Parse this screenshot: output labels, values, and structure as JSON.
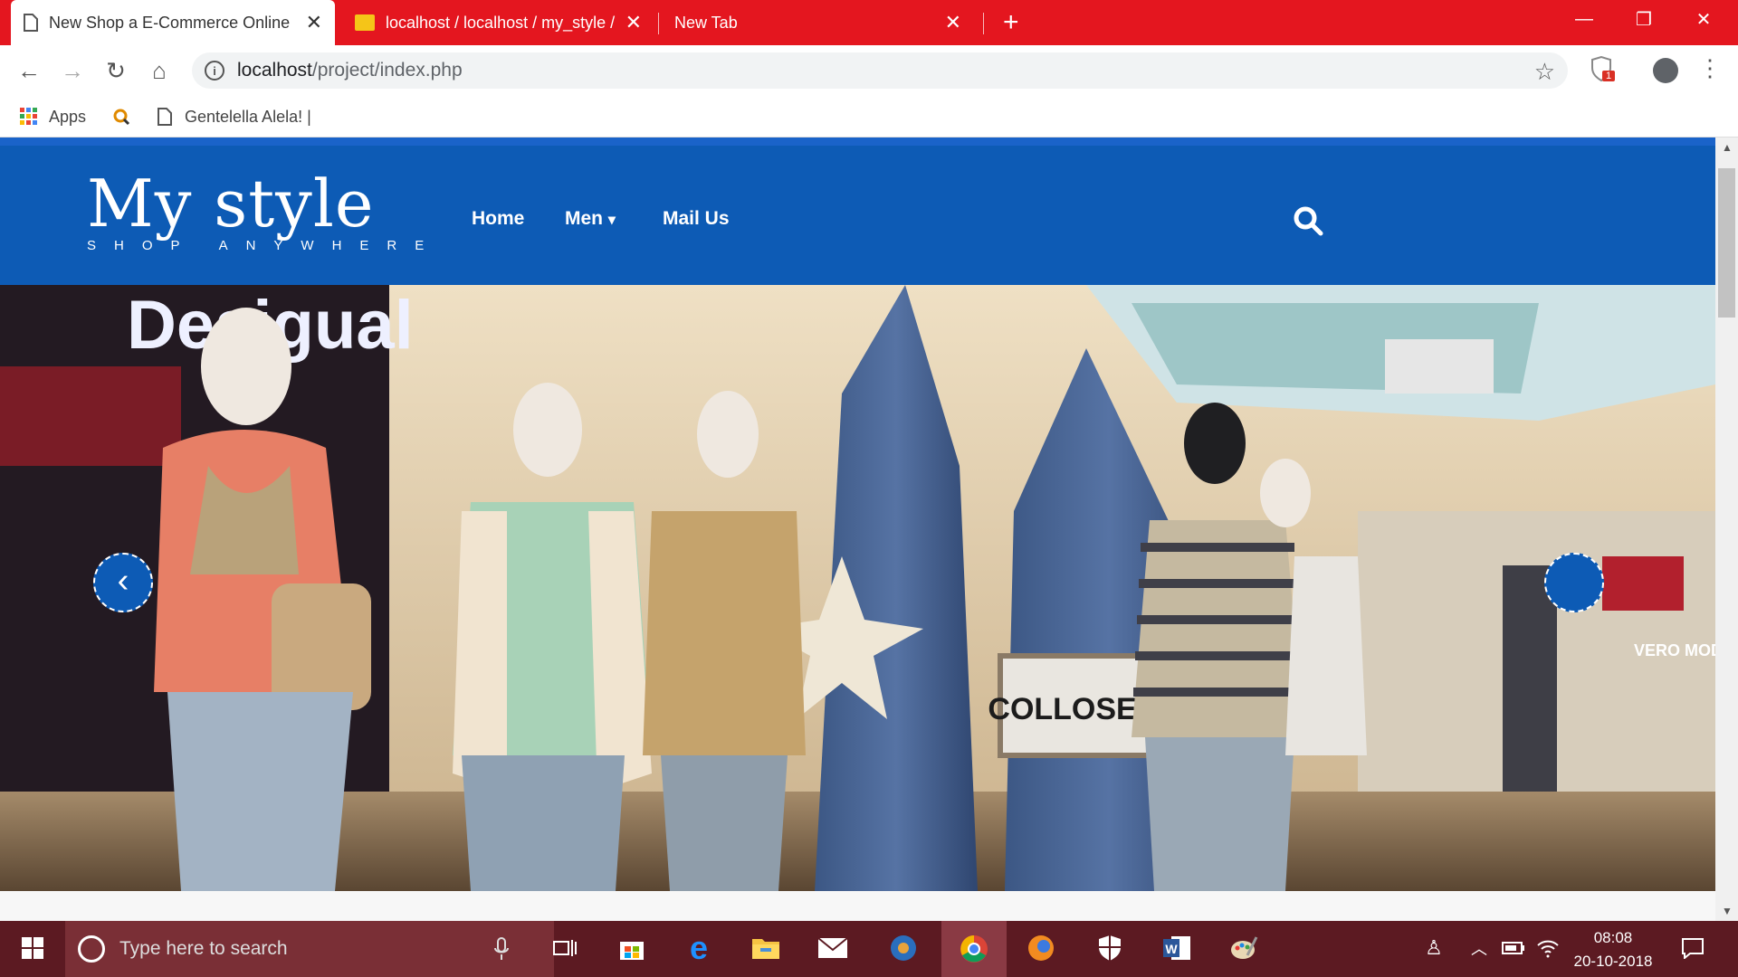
{
  "browser": {
    "tabs": [
      {
        "title": "New Shop a E-Commerce Online",
        "close": "✕"
      },
      {
        "title": "localhost / localhost / my_style / ",
        "close": "✕"
      },
      {
        "title": "New Tab",
        "close": "✕"
      }
    ],
    "new_tab": "+",
    "window_controls": {
      "minimize": "—",
      "restore": "❐",
      "close": "✕"
    },
    "nav": {
      "back": "←",
      "forward": "→",
      "reload": "↻",
      "home": "⌂"
    },
    "address": {
      "host": "localhost",
      "path": "/project/index.php"
    },
    "star": "☆",
    "extension_badge": "1",
    "menu": "⋮",
    "bookmarks": [
      {
        "label": "Apps",
        "icon": "apps-grid-icon"
      },
      {
        "label": "",
        "icon": "magnifier-bookmark-icon"
      },
      {
        "label": "Gentelella Alela! |",
        "icon": "page-icon"
      }
    ]
  },
  "site": {
    "logo_main": "My style",
    "logo_sub": "SHOP ANYWHERE",
    "nav": [
      {
        "label": "Home"
      },
      {
        "label": "Men",
        "caret": "▾"
      },
      {
        "label": "Mail Us"
      }
    ],
    "hero": {
      "sign_text": "COLLOSEUM",
      "store_text": "Desigual",
      "side_text": "VERO MODA",
      "prev": "‹"
    }
  },
  "taskbar": {
    "search_placeholder": "Type here to search",
    "time": "08:08",
    "date": "20-10-2018"
  },
  "colors": {
    "tab_red": "#e4161f",
    "site_blue": "#0d5bb5",
    "taskbar": "#5c1a22"
  }
}
